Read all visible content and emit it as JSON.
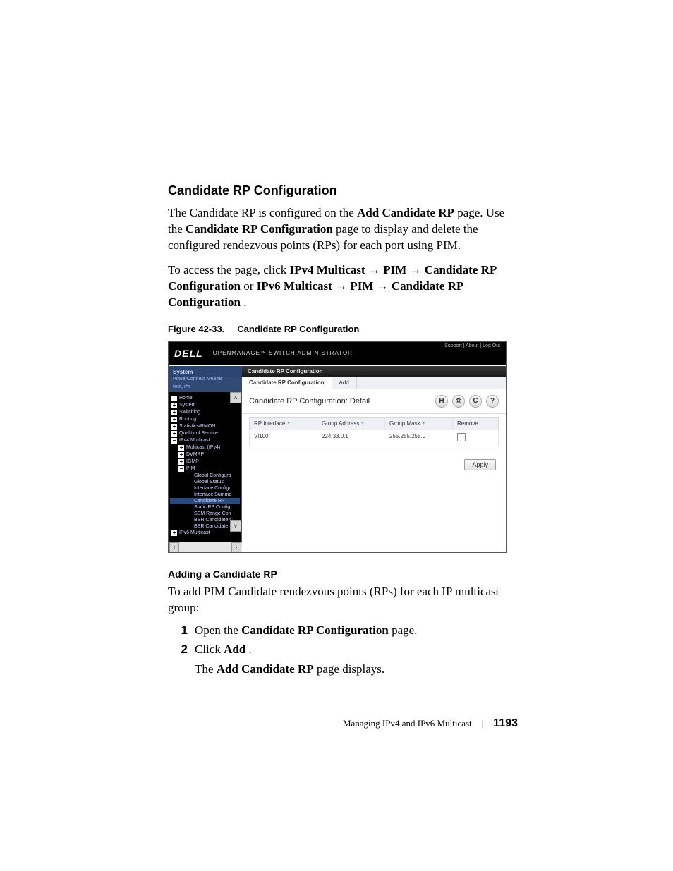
{
  "heading": "Candidate RP Configuration",
  "para1": {
    "pre": "The Candidate RP is configured on the ",
    "b1": "Add Candidate RP",
    "mid1": " page. Use the ",
    "b2": "Candidate RP Configuration",
    "post": " page to display and delete the configured rendezvous points (RPs) for each port using PIM."
  },
  "para2": {
    "pre": "To access the page, click ",
    "b1": "IPv4 Multicast",
    "arr1": " → ",
    "b2": "PIM",
    "arr2": " → ",
    "b3": "Candidate RP Configuration",
    "or": " or ",
    "b4": "IPv6 Multicast",
    "arr3": " → ",
    "b5": "PIM",
    "arr4": " → ",
    "b6": "Candidate RP Configuration",
    "end": "."
  },
  "figcap_no": "Figure 42-33.",
  "figcap_title": "Candidate RP Configuration",
  "subhead": "Adding a Candidate RP",
  "para3": "To add PIM Candidate rendezvous points (RPs) for each IP multicast group:",
  "steps": {
    "s1_num": "1",
    "s1_pre": "Open the ",
    "s1_b": "Candidate RP Configuration",
    "s1_post": " page.",
    "s2_num": "2",
    "s2_pre": "Click ",
    "s2_b": "Add",
    "s2_post": ".",
    "s2c_pre": "The ",
    "s2c_b": "Add Candidate RP",
    "s2c_post": " page displays."
  },
  "footer": {
    "section": "Managing IPv4 and IPv6 Multicast",
    "page": "1193"
  },
  "shot": {
    "brand": "DELL",
    "admin": "OPENMANAGE™  SWITCH  ADMINISTRATOR",
    "toplinks": "Support  |  About  |  Log Out",
    "system": "System",
    "model": "PowerConnect M6348",
    "user": "root, r/w",
    "nav": {
      "home": "Home",
      "system": "System",
      "switching": "Switching",
      "routing": "Routing",
      "stats": "Statistics/RMON",
      "qos": "Quality of Service",
      "ipv4": "IPv4 Multicast",
      "mcast": "Multicast (IPv4)",
      "dvmrp": "DVMRP",
      "igmp": "IGMP",
      "pim": "PIM",
      "gconf": "Global Configura",
      "gstat": "Global Status",
      "iconf": "Interface Configu",
      "isumm": "Interface Summa",
      "cand": "Candidate RP",
      "static": "Static RP Config",
      "ssm": "SSM Range Con",
      "bsr1": "BSR Candidate C",
      "bsr2": "BSR Candidate S",
      "ipv6": "IPv6 Multicast"
    },
    "crumb": "Candidate RP Configuration",
    "tab_active": "Candidate RP Configuration",
    "tab_add": "Add",
    "detail_title": "Candidate RP Configuration: Detail",
    "icons": {
      "save": "H",
      "print": "⎙",
      "refresh": "C",
      "help": "?"
    },
    "table": {
      "h1": "RP Interface",
      "h2": "Group Address",
      "h3": "Group Mask",
      "h4": "Remove",
      "r1c1": "Vl100",
      "r1c2": "224.33.0.1",
      "r1c3": "255.255.255.0"
    },
    "apply": "Apply"
  }
}
